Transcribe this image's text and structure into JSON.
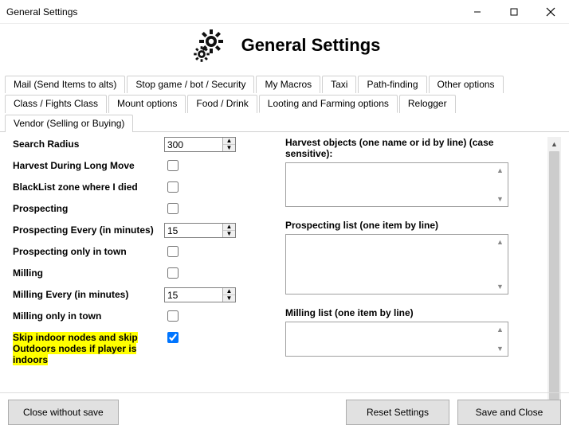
{
  "window": {
    "title": "General Settings"
  },
  "header": {
    "title": "General Settings"
  },
  "tabs": [
    {
      "label": "Mail (Send Items to alts)",
      "active": false
    },
    {
      "label": "Stop game / bot / Security",
      "active": false
    },
    {
      "label": "My Macros",
      "active": false
    },
    {
      "label": "Taxi",
      "active": false
    },
    {
      "label": "Path-finding",
      "active": false
    },
    {
      "label": "Other options",
      "active": false
    },
    {
      "label": "Class / Fights Class",
      "active": false
    },
    {
      "label": "Mount options",
      "active": false
    },
    {
      "label": "Food / Drink",
      "active": false
    },
    {
      "label": "Looting and Farming options",
      "active": true
    },
    {
      "label": "Relogger",
      "active": false
    },
    {
      "label": "Vendor (Selling or Buying)",
      "active": false
    }
  ],
  "left": {
    "search_radius": {
      "label": "Search Radius",
      "value": "300"
    },
    "harvest_long_move": {
      "label": "Harvest During Long Move",
      "checked": false
    },
    "blacklist_died": {
      "label": "BlackList zone where I died",
      "checked": false
    },
    "prospecting": {
      "label": "Prospecting",
      "checked": false
    },
    "prospecting_every": {
      "label": "Prospecting Every (in minutes)",
      "value": "15"
    },
    "prospecting_only_town": {
      "label": "Prospecting only in town",
      "checked": false
    },
    "milling": {
      "label": "Milling",
      "checked": false
    },
    "milling_every": {
      "label": "Milling Every (in minutes)",
      "value": "15"
    },
    "milling_only_town": {
      "label": "Milling only in town",
      "checked": false
    },
    "skip_indoor": {
      "label": "Skip indoor nodes and skip Outdoors nodes if player is indoors",
      "checked": true
    }
  },
  "right": {
    "harvest_list": {
      "label": "Harvest objects (one name or id by line) (case sensitive):",
      "value": ""
    },
    "prospecting_list": {
      "label": "Prospecting list (one item by line)",
      "value": ""
    },
    "milling_list": {
      "label": "Milling list (one item by line)",
      "value": ""
    }
  },
  "footer": {
    "close_no_save": "Close without save",
    "reset": "Reset Settings",
    "save_close": "Save and Close"
  }
}
